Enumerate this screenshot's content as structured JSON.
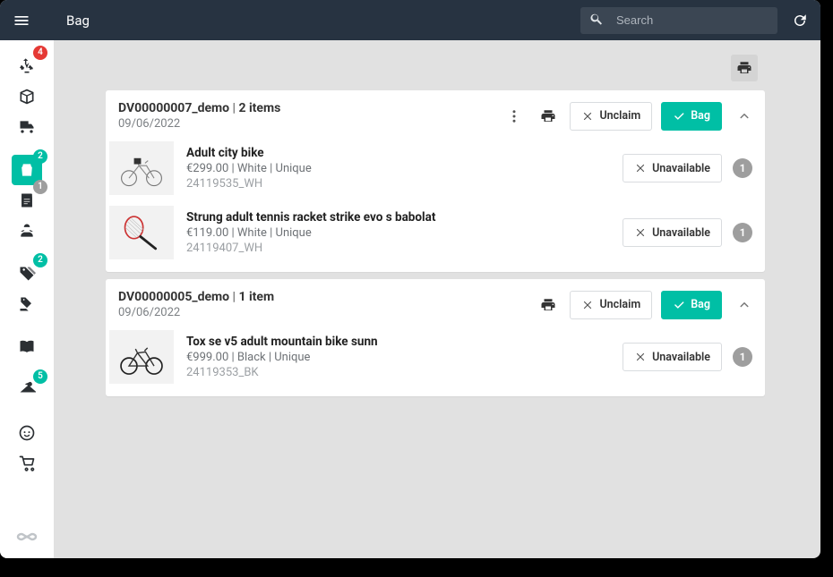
{
  "header": {
    "title": "Bag",
    "search_placeholder": "Search"
  },
  "sidebar": {
    "items": [
      {
        "name": "downloads",
        "badge": "4",
        "badge_color": "b-red"
      },
      {
        "name": "package",
        "badge": null
      },
      {
        "name": "truck",
        "badge": null
      },
      {
        "name": "bag",
        "badge": "2",
        "badge_color": "b-teal",
        "active": true
      },
      {
        "name": "note",
        "badge": "1",
        "badge_color": "b-gray"
      },
      {
        "name": "handover",
        "badge": null
      },
      {
        "name": "tags",
        "badge": "2",
        "badge_color": "b-teal"
      },
      {
        "name": "tag-hand",
        "badge": null
      },
      {
        "name": "book",
        "badge": null
      },
      {
        "name": "hanger",
        "badge": "5",
        "badge_color": "b-teal"
      },
      {
        "name": "face",
        "badge": null
      },
      {
        "name": "cart",
        "badge": null
      }
    ]
  },
  "orders": [
    {
      "ref": "DV00000007_demo",
      "count_label": "2 items",
      "date": "09/06/2022",
      "show_dots": true,
      "unclaim_label": "Unclaim",
      "bag_label": "Bag",
      "items": [
        {
          "name": "Adult city bike",
          "meta": "€299.00 | White | Unique",
          "sku": "24119535_WH",
          "unavailable_label": "Unavailable",
          "qty": "1",
          "thumb": "citybike"
        },
        {
          "name": "Strung adult tennis racket strike evo s babolat",
          "meta": "€119.00 | White | Unique",
          "sku": "24119407_WH",
          "unavailable_label": "Unavailable",
          "qty": "1",
          "thumb": "racket"
        }
      ]
    },
    {
      "ref": "DV00000005_demo",
      "count_label": "1 item",
      "date": "09/06/2022",
      "show_dots": false,
      "unclaim_label": "Unclaim",
      "bag_label": "Bag",
      "items": [
        {
          "name": "Tox se v5 adult mountain bike sunn",
          "meta": "€999.00 | Black | Unique",
          "sku": "24119353_BK",
          "unavailable_label": "Unavailable",
          "qty": "1",
          "thumb": "mtb"
        }
      ]
    }
  ]
}
